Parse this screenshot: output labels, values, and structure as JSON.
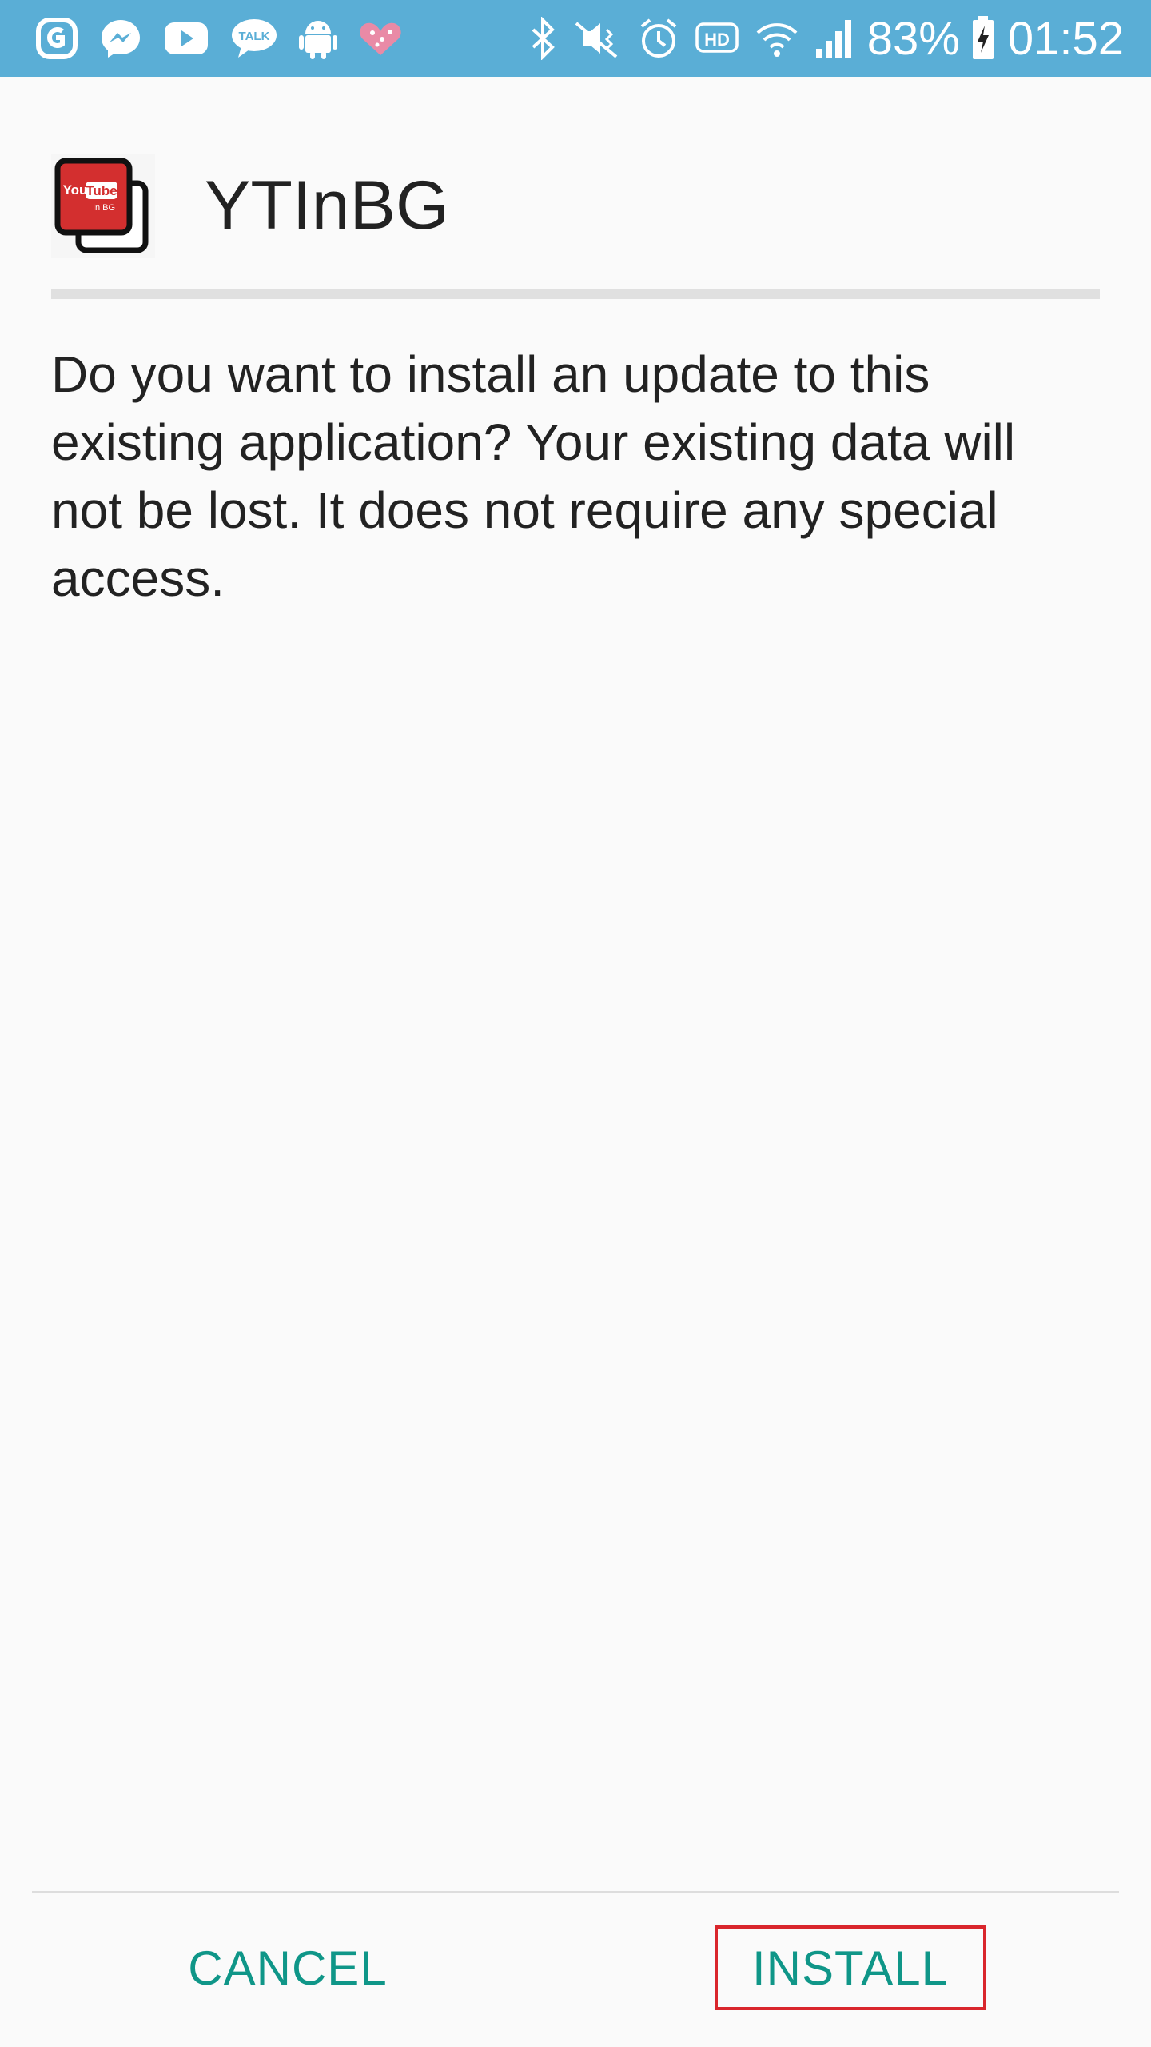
{
  "status_bar": {
    "left_icons": [
      "glide-icon",
      "messenger-icon",
      "youtube-icon",
      "kakaotalk-icon",
      "android-icon",
      "heart-icon"
    ],
    "kakaotalk_label": "TALK",
    "right_icons": [
      "bluetooth-icon",
      "mute-icon",
      "alarm-icon",
      "hd-icon",
      "wifi-icon",
      "signal-icon"
    ],
    "hd_label": "HD",
    "battery_percent": "83%",
    "time": "01:52",
    "background_color": "#5aaed6"
  },
  "app": {
    "name": "YTInBG",
    "icon_label_top": "You",
    "icon_label_tube": "Tube",
    "icon_label_sub": "In BG",
    "icon_color": "#d32f2f"
  },
  "dialog": {
    "message": "Do you want to install an update to this existing application? Your existing data will not be lost. It does not require any special access."
  },
  "buttons": {
    "cancel": "CANCEL",
    "install": "INSTALL",
    "accent_color": "#0f9688",
    "highlight_color": "#d9262c"
  }
}
